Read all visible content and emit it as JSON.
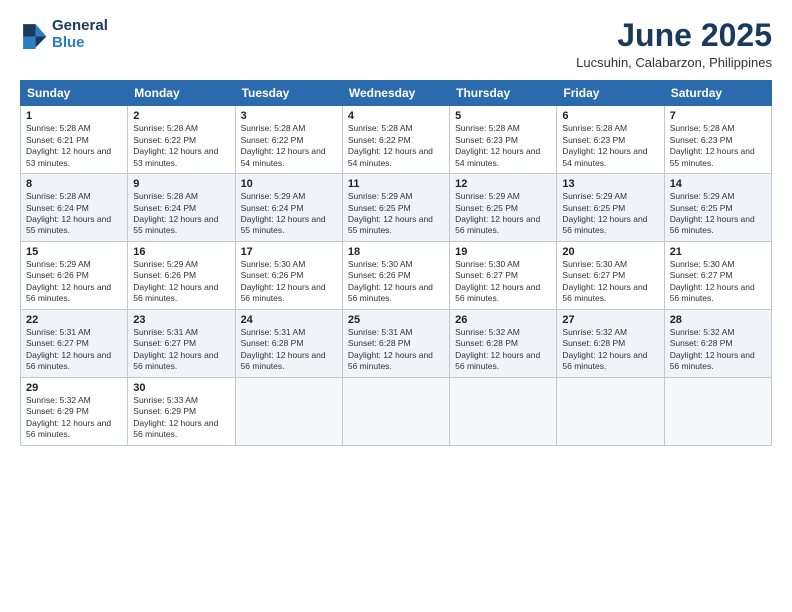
{
  "logo": {
    "line1": "General",
    "line2": "Blue"
  },
  "title": "June 2025",
  "subtitle": "Lucsuhin, Calabarzon, Philippines",
  "weekdays": [
    "Sunday",
    "Monday",
    "Tuesday",
    "Wednesday",
    "Thursday",
    "Friday",
    "Saturday"
  ],
  "weeks": [
    [
      {
        "day": "1",
        "sunrise": "5:28 AM",
        "sunset": "6:21 PM",
        "daylight": "12 hours and 53 minutes."
      },
      {
        "day": "2",
        "sunrise": "5:28 AM",
        "sunset": "6:22 PM",
        "daylight": "12 hours and 53 minutes."
      },
      {
        "day": "3",
        "sunrise": "5:28 AM",
        "sunset": "6:22 PM",
        "daylight": "12 hours and 54 minutes."
      },
      {
        "day": "4",
        "sunrise": "5:28 AM",
        "sunset": "6:22 PM",
        "daylight": "12 hours and 54 minutes."
      },
      {
        "day": "5",
        "sunrise": "5:28 AM",
        "sunset": "6:23 PM",
        "daylight": "12 hours and 54 minutes."
      },
      {
        "day": "6",
        "sunrise": "5:28 AM",
        "sunset": "6:23 PM",
        "daylight": "12 hours and 54 minutes."
      },
      {
        "day": "7",
        "sunrise": "5:28 AM",
        "sunset": "6:23 PM",
        "daylight": "12 hours and 55 minutes."
      }
    ],
    [
      {
        "day": "8",
        "sunrise": "5:28 AM",
        "sunset": "6:24 PM",
        "daylight": "12 hours and 55 minutes."
      },
      {
        "day": "9",
        "sunrise": "5:28 AM",
        "sunset": "6:24 PM",
        "daylight": "12 hours and 55 minutes."
      },
      {
        "day": "10",
        "sunrise": "5:29 AM",
        "sunset": "6:24 PM",
        "daylight": "12 hours and 55 minutes."
      },
      {
        "day": "11",
        "sunrise": "5:29 AM",
        "sunset": "6:25 PM",
        "daylight": "12 hours and 55 minutes."
      },
      {
        "day": "12",
        "sunrise": "5:29 AM",
        "sunset": "6:25 PM",
        "daylight": "12 hours and 56 minutes."
      },
      {
        "day": "13",
        "sunrise": "5:29 AM",
        "sunset": "6:25 PM",
        "daylight": "12 hours and 56 minutes."
      },
      {
        "day": "14",
        "sunrise": "5:29 AM",
        "sunset": "6:25 PM",
        "daylight": "12 hours and 56 minutes."
      }
    ],
    [
      {
        "day": "15",
        "sunrise": "5:29 AM",
        "sunset": "6:26 PM",
        "daylight": "12 hours and 56 minutes."
      },
      {
        "day": "16",
        "sunrise": "5:29 AM",
        "sunset": "6:26 PM",
        "daylight": "12 hours and 56 minutes."
      },
      {
        "day": "17",
        "sunrise": "5:30 AM",
        "sunset": "6:26 PM",
        "daylight": "12 hours and 56 minutes."
      },
      {
        "day": "18",
        "sunrise": "5:30 AM",
        "sunset": "6:26 PM",
        "daylight": "12 hours and 56 minutes."
      },
      {
        "day": "19",
        "sunrise": "5:30 AM",
        "sunset": "6:27 PM",
        "daylight": "12 hours and 56 minutes."
      },
      {
        "day": "20",
        "sunrise": "5:30 AM",
        "sunset": "6:27 PM",
        "daylight": "12 hours and 56 minutes."
      },
      {
        "day": "21",
        "sunrise": "5:30 AM",
        "sunset": "6:27 PM",
        "daylight": "12 hours and 56 minutes."
      }
    ],
    [
      {
        "day": "22",
        "sunrise": "5:31 AM",
        "sunset": "6:27 PM",
        "daylight": "12 hours and 56 minutes."
      },
      {
        "day": "23",
        "sunrise": "5:31 AM",
        "sunset": "6:27 PM",
        "daylight": "12 hours and 56 minutes."
      },
      {
        "day": "24",
        "sunrise": "5:31 AM",
        "sunset": "6:28 PM",
        "daylight": "12 hours and 56 minutes."
      },
      {
        "day": "25",
        "sunrise": "5:31 AM",
        "sunset": "6:28 PM",
        "daylight": "12 hours and 56 minutes."
      },
      {
        "day": "26",
        "sunrise": "5:32 AM",
        "sunset": "6:28 PM",
        "daylight": "12 hours and 56 minutes."
      },
      {
        "day": "27",
        "sunrise": "5:32 AM",
        "sunset": "6:28 PM",
        "daylight": "12 hours and 56 minutes."
      },
      {
        "day": "28",
        "sunrise": "5:32 AM",
        "sunset": "6:28 PM",
        "daylight": "12 hours and 56 minutes."
      }
    ],
    [
      {
        "day": "29",
        "sunrise": "5:32 AM",
        "sunset": "6:29 PM",
        "daylight": "12 hours and 56 minutes."
      },
      {
        "day": "30",
        "sunrise": "5:33 AM",
        "sunset": "6:29 PM",
        "daylight": "12 hours and 56 minutes."
      },
      null,
      null,
      null,
      null,
      null
    ]
  ]
}
